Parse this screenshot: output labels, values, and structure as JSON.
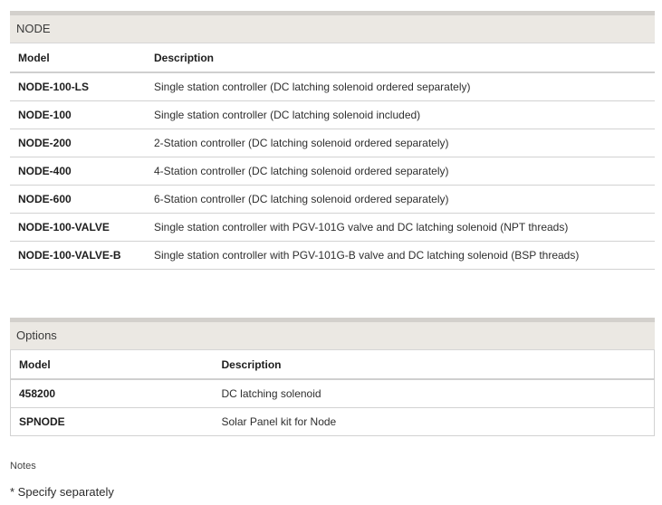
{
  "node_section": {
    "title": "NODE",
    "headers": {
      "model": "Model",
      "description": "Description"
    },
    "rows": [
      {
        "model": "NODE-100-LS",
        "description": "Single station controller (DC latching solenoid ordered separately)"
      },
      {
        "model": "NODE-100",
        "description": "Single station controller (DC latching solenoid included)"
      },
      {
        "model": "NODE-200",
        "description": "2-Station controller (DC latching solenoid ordered separately)"
      },
      {
        "model": "NODE-400",
        "description": "4-Station controller (DC latching solenoid ordered separately)"
      },
      {
        "model": "NODE-600",
        "description": "6-Station controller (DC latching solenoid ordered separately)"
      },
      {
        "model": "NODE-100-VALVE",
        "description": "Single station controller with PGV-101G valve and DC latching solenoid (NPT threads)"
      },
      {
        "model": "NODE-100-VALVE-B",
        "description": "Single station controller with PGV-101G-B valve and DC latching solenoid (BSP threads)"
      }
    ]
  },
  "options_section": {
    "title": "Options",
    "headers": {
      "model": "Model",
      "description": "Description"
    },
    "rows": [
      {
        "model": "458200",
        "description": "DC latching solenoid"
      },
      {
        "model": "SPNODE",
        "description": "Solar Panel kit for Node"
      }
    ]
  },
  "notes": {
    "title": "Notes",
    "text": "* Specify separately"
  }
}
